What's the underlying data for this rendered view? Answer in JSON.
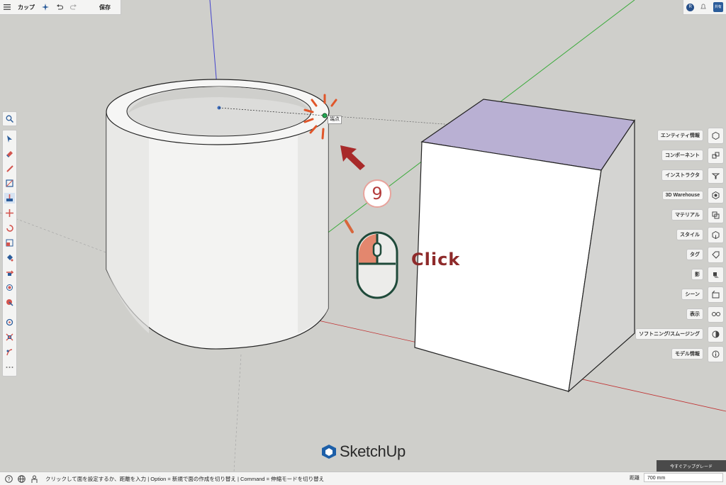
{
  "toolbar": {
    "doc_title": "カップ",
    "save_label": "保存"
  },
  "topright": {
    "avatar_letter": "R",
    "share_label": "共有"
  },
  "tooltip": {
    "label": "端点"
  },
  "annotation": {
    "step_number": "9",
    "click_text": "Click"
  },
  "right_panel": {
    "items": [
      {
        "label": "エンティティ情報",
        "icon": "entity-info-icon"
      },
      {
        "label": "コンポーネント",
        "icon": "components-icon"
      },
      {
        "label": "インストラクタ",
        "icon": "instructor-icon"
      },
      {
        "label": "3D Warehouse",
        "icon": "warehouse-icon"
      },
      {
        "label": "マテリアル",
        "icon": "materials-icon"
      },
      {
        "label": "スタイル",
        "icon": "styles-icon"
      },
      {
        "label": "タグ",
        "icon": "tags-icon"
      },
      {
        "label": "影",
        "icon": "shadows-icon"
      },
      {
        "label": "シーン",
        "icon": "scenes-icon"
      },
      {
        "label": "表示",
        "icon": "display-icon"
      },
      {
        "label": "ソフトニング/スムージング",
        "icon": "soften-icon"
      },
      {
        "label": "モデル情報",
        "icon": "model-info-icon"
      }
    ]
  },
  "upgrade": {
    "label": "今すぐアップグレード"
  },
  "status": {
    "hint": "クリックして面を設定するか、距離を入力 | Option = 新規で面の作成を切り替え | Command = 伸縮モードを切り替え",
    "distance_label": "距離",
    "distance_value": "700 mm"
  },
  "logo": {
    "text": "SketchUp"
  },
  "colors": {
    "accent": "#2b5c9a",
    "annotation_red": "#b43c3c",
    "mouse_green": "#1f4a3a"
  }
}
